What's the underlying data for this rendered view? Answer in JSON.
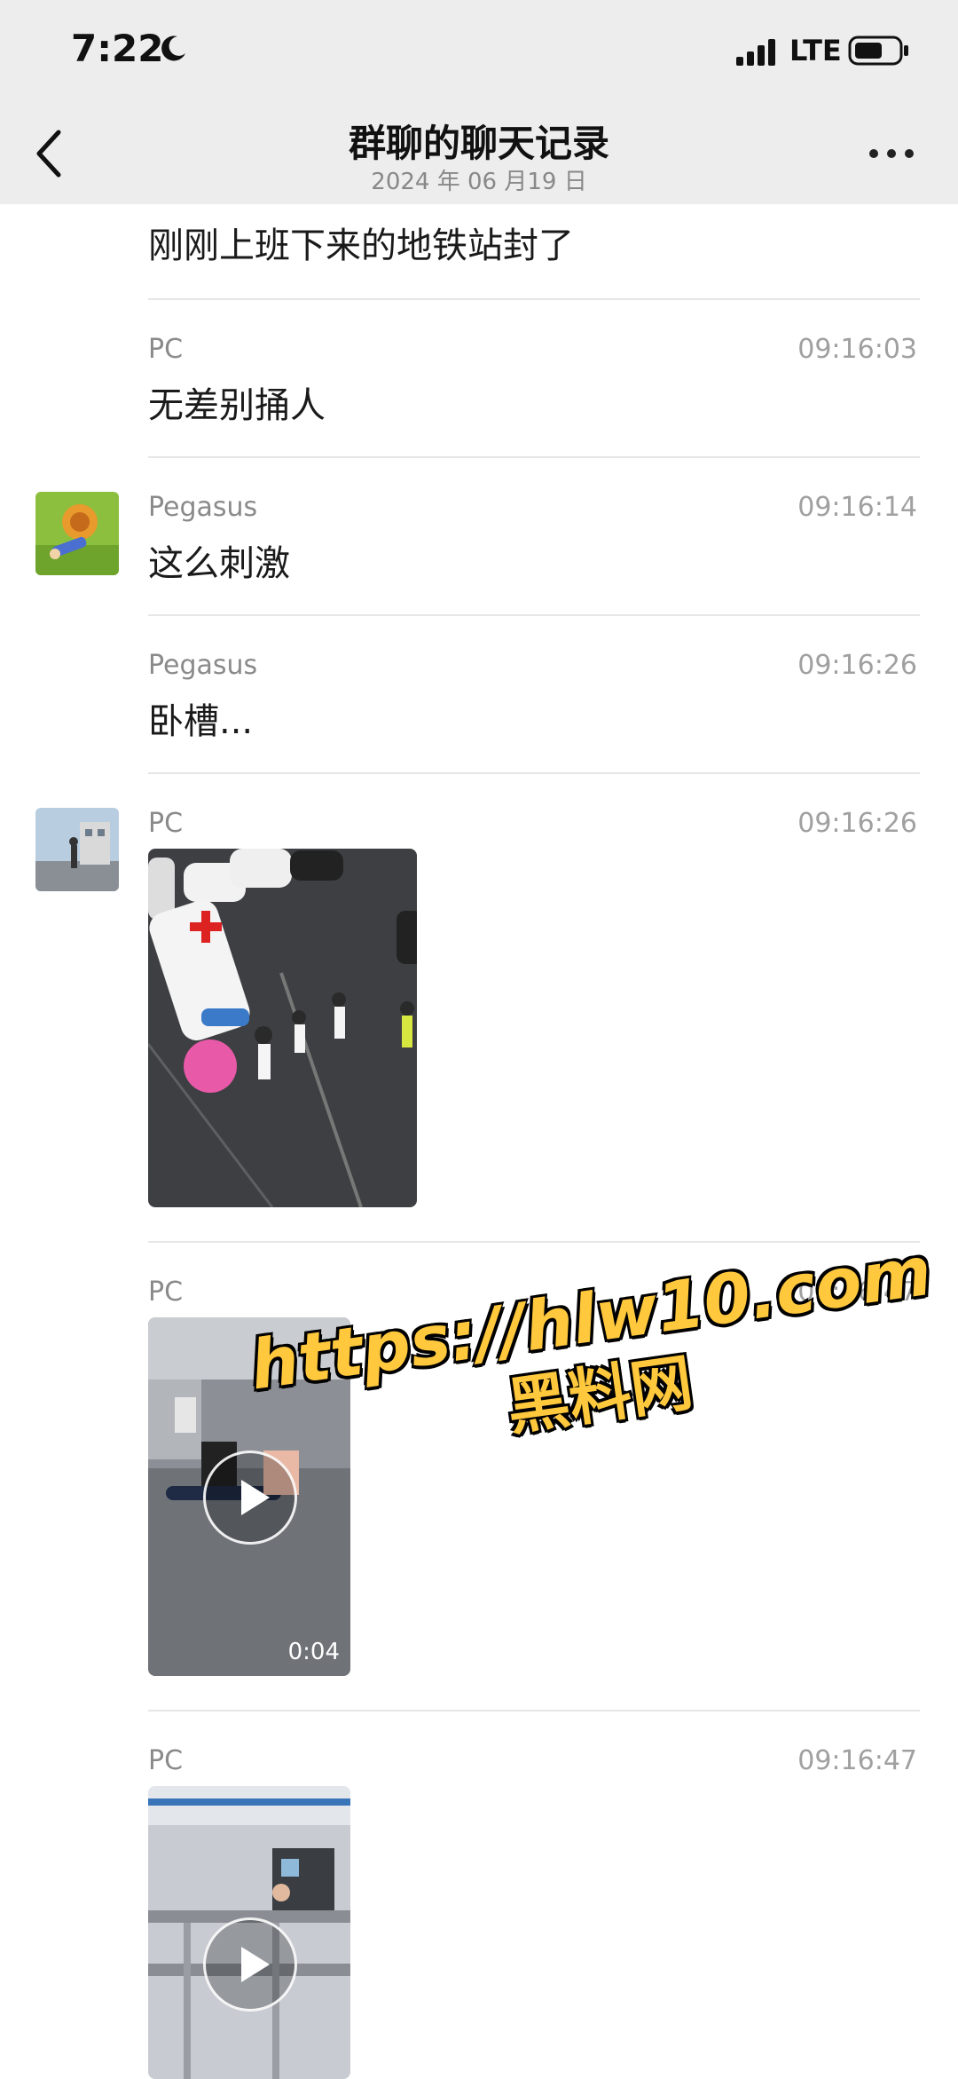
{
  "status": {
    "time": "7:22",
    "network": "LTE"
  },
  "nav": {
    "title": "群聊的聊天记录",
    "subtitle": "2024 年 06 月19 日"
  },
  "messages": [
    {
      "text": "刚刚上班下来的地铁站封了"
    },
    {
      "sender": "PC",
      "time": "09:16:03",
      "text": "无差别捅人"
    },
    {
      "sender": "Pegasus",
      "time": "09:16:14",
      "text": "这么刺激"
    },
    {
      "sender": "Pegasus",
      "time": "09:16:26",
      "text": "卧槽..."
    },
    {
      "sender": "PC",
      "time": "09:16:26",
      "media": "image"
    },
    {
      "sender": "PC",
      "time": "09:16:47",
      "media": "video",
      "duration": "0:04"
    },
    {
      "sender": "PC",
      "time": "09:16:47",
      "media": "video"
    }
  ],
  "watermark": {
    "url": "https://hlw10.com",
    "name": "黑料网"
  }
}
